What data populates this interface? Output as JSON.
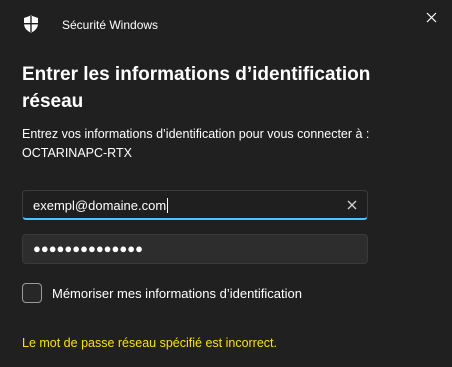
{
  "window": {
    "app_title": "Sécurité Windows",
    "close_icon": "close-icon",
    "app_icon": "shield-icon"
  },
  "dialog": {
    "heading": "Entrer les informations d’identification réseau",
    "prompt_line1": "Entrez vos informations d’identification pour vous connecter à :",
    "prompt_line2": "OCTARINAPC-RTX"
  },
  "username": {
    "value": "exempl@domaine.com",
    "clear_icon": "clear-icon"
  },
  "password": {
    "masked_value": "●●●●●●●●●●●●●●"
  },
  "remember": {
    "label": "Mémoriser mes informations d’identification",
    "checked": false
  },
  "error": {
    "message": "Le mot de passe réseau spécifié est incorrect."
  },
  "colors": {
    "background": "#202020",
    "accent": "#4cc2ff",
    "error": "#fce100",
    "text": "#ffffff"
  }
}
